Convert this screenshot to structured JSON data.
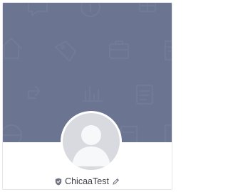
{
  "profile": {
    "display_name": "ChicaaTest",
    "badge_icon": "shield-icon",
    "edit_icon": "pencil-icon",
    "avatar_icon": "default-user-avatar-icon"
  },
  "cover": {
    "background_color": "#6b7592",
    "pattern_icons": [
      "chat-bubble-icon",
      "info-icon",
      "grid-icon",
      "home-icon",
      "tag-icon",
      "briefcase-icon",
      "document-icon",
      "share-arrow-icon",
      "bar-chart-icon",
      "clipboard-icon",
      "globe-icon",
      "document-icon"
    ]
  }
}
